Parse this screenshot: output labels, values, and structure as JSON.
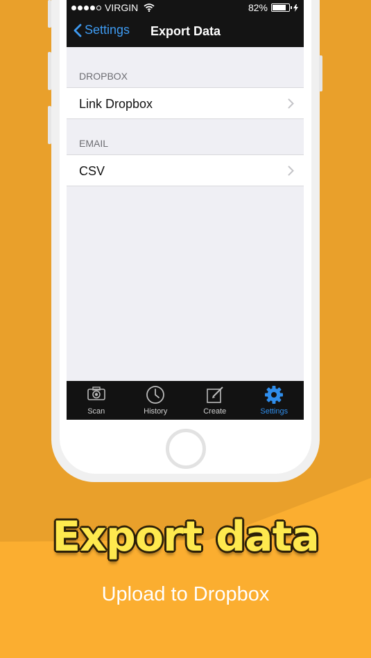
{
  "status": {
    "carrier": "VIRGIN",
    "battery": "82%",
    "battery_level": 0.82
  },
  "nav": {
    "back_label": "Settings",
    "title": "Export Data"
  },
  "sections": [
    {
      "header": "DROPBOX",
      "items": [
        {
          "label": "Link Dropbox"
        }
      ]
    },
    {
      "header": "EMAIL",
      "items": [
        {
          "label": "CSV"
        }
      ]
    }
  ],
  "tabs": [
    {
      "label": "Scan",
      "icon": "camera-icon"
    },
    {
      "label": "History",
      "icon": "clock-icon"
    },
    {
      "label": "Create",
      "icon": "compose-icon"
    },
    {
      "label": "Settings",
      "icon": "gear-icon",
      "active": true
    }
  ],
  "promo": {
    "headline": "Export data",
    "subheadline": "Upload to Dropbox"
  },
  "colors": {
    "background": "#FBAE30",
    "accent": "#2F8DEB",
    "headline": "#FEE94E"
  }
}
